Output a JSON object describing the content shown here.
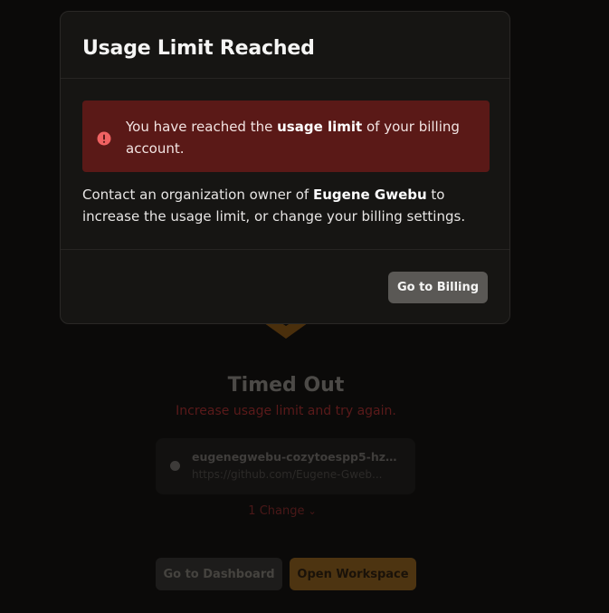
{
  "modal": {
    "title": "Usage Limit Reached",
    "alert": {
      "icon": "exclamation-circle-icon",
      "text_before": "You have reached the ",
      "text_emphasis": "usage limit",
      "text_after": " of your billing account.",
      "color": "#5a1917"
    },
    "body": {
      "text_before": "Contact an organization owner of ",
      "org_name": "Eugene Gwebu",
      "text_after": " to increase the usage limit, or change your billing settings."
    },
    "billing_button_label": "Go to Billing"
  },
  "background": {
    "logo_icon": "gitpod-logo-icon",
    "status_title": "Timed Out",
    "status_subtitle": "Increase usage limit and try again.",
    "repo": {
      "name": "eugenegwebu-cozytoespp5-hzm...",
      "url": "https://github.com/Eugene-Gweb..."
    },
    "changes_label": "1 Change",
    "changes_icon": "chevron-down-icon",
    "dashboard_button_label": "Go to Dashboard",
    "open_workspace_button_label": "Open Workspace"
  },
  "colors": {
    "accent_orange": "#ffae33",
    "danger_red": "#f87171",
    "page_bg": "#0b0a09",
    "modal_bg": "#161513"
  }
}
